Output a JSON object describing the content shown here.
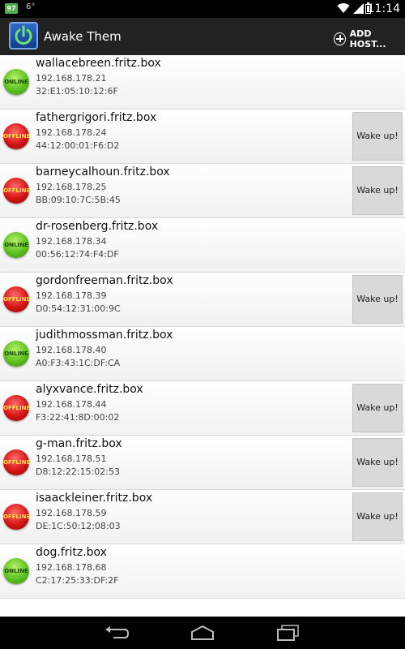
{
  "status_bar": {
    "badge": "97",
    "temp": "6°",
    "time": "11:14"
  },
  "action_bar": {
    "title": "Awake Them",
    "add_host_label": "ADD HOST..."
  },
  "hosts": [
    {
      "name": "wallacebreen.fritz.box",
      "ip": "192.168.178.21",
      "mac": "32:E1:05:10:12:6F",
      "status": "online",
      "status_label": "ONLINE"
    },
    {
      "name": "fathergrigori.fritz.box",
      "ip": "192.168.178.24",
      "mac": "44:12:00:01:F6:D2",
      "status": "offline",
      "status_label": "OFFLINE",
      "wake_label": "Wake up!"
    },
    {
      "name": "barneycalhoun.fritz.box",
      "ip": "192.168.178.25",
      "mac": "BB:09:10:7C:5B:45",
      "status": "offline",
      "status_label": "OFFLINE",
      "wake_label": "Wake up!"
    },
    {
      "name": "dr-rosenberg.fritz.box",
      "ip": "192.168.178.34",
      "mac": "00:56:12:74:F4:DF",
      "status": "online",
      "status_label": "ONLINE"
    },
    {
      "name": "gordonfreeman.fritz.box",
      "ip": "192.168.178.39",
      "mac": "D0:54:12:31:00:9C",
      "status": "offline",
      "status_label": "OFFLINE",
      "wake_label": "Wake up!"
    },
    {
      "name": "judithmossman.fritz.box",
      "ip": "192.168.178.40",
      "mac": "A0:F3:43:1C:DF:CA",
      "status": "online",
      "status_label": "ONLINE"
    },
    {
      "name": "alyxvance.fritz.box",
      "ip": "192.168.178.44",
      "mac": "F3:22:41:8D:00:02",
      "status": "offline",
      "status_label": "OFFLINE",
      "wake_label": "Wake up!"
    },
    {
      "name": "g-man.fritz.box",
      "ip": "192.168.178.51",
      "mac": "D8:12:22:15:02:53",
      "status": "offline",
      "status_label": "OFFLINE",
      "wake_label": "Wake up!"
    },
    {
      "name": "isaackleiner.fritz.box",
      "ip": "192.168.178.59",
      "mac": "DE:1C:50:12:08:03",
      "status": "offline",
      "status_label": "OFFLINE",
      "wake_label": "Wake up!"
    },
    {
      "name": "dog.fritz.box",
      "ip": "192.168.178.68",
      "mac": "C2:17:25:33:DF:2F",
      "status": "online",
      "status_label": "ONLINE"
    }
  ],
  "icons": {
    "app": "power-icon",
    "add": "add-circle-icon",
    "back": "back-icon",
    "home": "home-icon",
    "recents": "recent-apps-icon"
  }
}
